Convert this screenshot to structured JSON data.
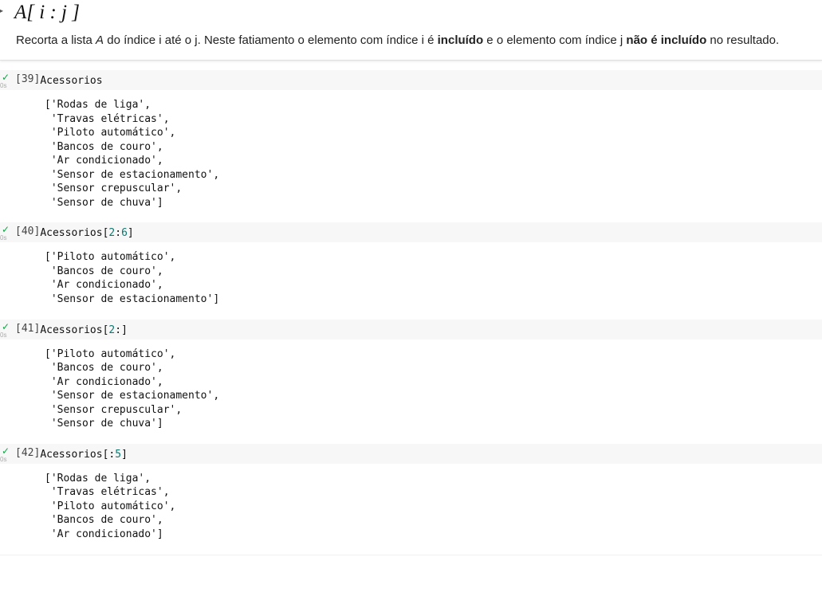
{
  "textcell": {
    "caret": "▸",
    "title": "A[ i : j ]",
    "desc_pre": "Recorta a lista ",
    "desc_var": "A",
    "desc_mid1": " do índice i até o j. Neste fatiamento o elemento com índice i é ",
    "desc_bold1": "incluído",
    "desc_mid2": " e o elemento com índice j ",
    "desc_bold2": "não é incluído",
    "desc_end": " no resultado."
  },
  "gutter_time": "0s",
  "cells": [
    {
      "num": "39",
      "code_plain": "Acessorios",
      "code_slice": "",
      "output": "['Rodas de liga',\n 'Travas elétricas',\n 'Piloto automático',\n 'Bancos de couro',\n 'Ar condicionado',\n 'Sensor de estacionamento',\n 'Sensor crepuscular',\n 'Sensor de chuva']"
    },
    {
      "num": "40",
      "code_plain": "Acessorios",
      "code_slice": "[2:6]",
      "output": "['Piloto automático',\n 'Bancos de couro',\n 'Ar condicionado',\n 'Sensor de estacionamento']"
    },
    {
      "num": "41",
      "code_plain": "Acessorios",
      "code_slice": "[2:]",
      "output": "['Piloto automático',\n 'Bancos de couro',\n 'Ar condicionado',\n 'Sensor de estacionamento',\n 'Sensor crepuscular',\n 'Sensor de chuva']"
    },
    {
      "num": "42",
      "code_plain": "Acessorios",
      "code_slice": "[:5]",
      "output": "['Rodas de liga',\n 'Travas elétricas',\n 'Piloto automático',\n 'Bancos de couro',\n 'Ar condicionado']"
    }
  ]
}
